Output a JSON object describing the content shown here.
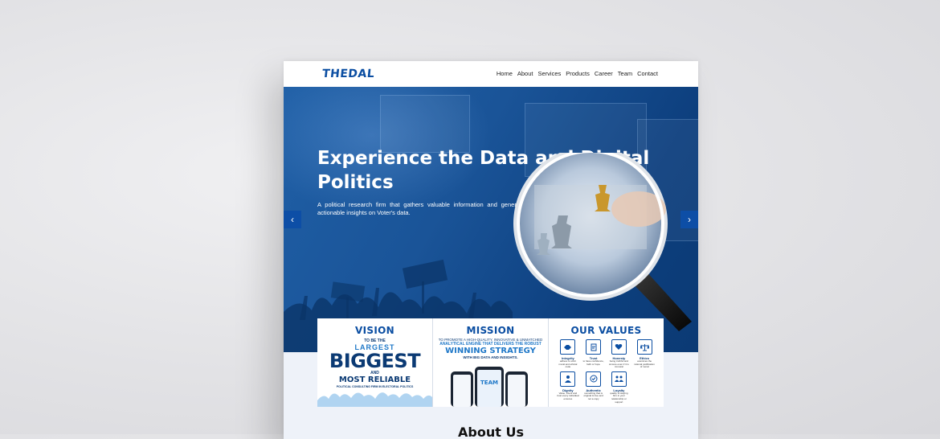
{
  "brand": {
    "logo_text": "THEDAL",
    "color": "#0b4ea2"
  },
  "nav": {
    "items": [
      "Home",
      "About",
      "Services",
      "Products",
      "Career",
      "Team",
      "Contact"
    ]
  },
  "hero": {
    "title": "Experience the Data and Digital Politics",
    "description": "A political research firm that gathers valuable information and generates actionable insights on Voter's data.",
    "prev_icon": "chevron-left-icon",
    "next_icon": "chevron-right-icon",
    "prev_glyph": "‹",
    "next_glyph": "›",
    "background_color": "#1a5498"
  },
  "cards": {
    "vision": {
      "title": "VISION",
      "line1": "TO BE THE",
      "line2": "LARGEST",
      "line3": "BIGGEST",
      "line4": "AND",
      "line5": "MOST RELIABLE",
      "line6": "POLITICAL CONSULTING FIRM IN ELECTORAL POLITICS"
    },
    "mission": {
      "title": "MISSION",
      "line1": "TO PROMOTE A HIGH-QUALITY, INNOVATIVE & UNMATCHED",
      "line2": "ANALYTICAL ENGINE THAT DELIVERS THE ROBUST",
      "line3": "WINNING STRATEGY",
      "line4": "WITH BIG DATA AND INSIGHTS.",
      "phone_logo": "TEAM"
    },
    "values": {
      "title": "OUR VALUES",
      "items": [
        {
          "name": "Integrity",
          "desc": "adhere to strict moral and ethical code",
          "icon": "handshake-icon"
        },
        {
          "name": "Trust",
          "desc": "to have confidence, faith or hope",
          "icon": "agreement-icon"
        },
        {
          "name": "Honesty",
          "desc": "being truthful and sincere even if it is immoral",
          "icon": "heart-hands-icon"
        },
        {
          "name": "Ethics",
          "desc": "examines the rational justification of moral",
          "icon": "scales-icon"
        },
        {
          "name": "Dignity",
          "desc": "Value, Intent and trust every individual ensures",
          "icon": "person-icon"
        },
        {
          "name": "Authentic",
          "desc": "something that is original & true and not a copy",
          "icon": "badge-icon"
        },
        {
          "name": "Loyalty",
          "desc": "quality of staying firm in your relationship or support",
          "icon": "group-icon"
        }
      ]
    }
  },
  "about": {
    "title": "About Us"
  }
}
